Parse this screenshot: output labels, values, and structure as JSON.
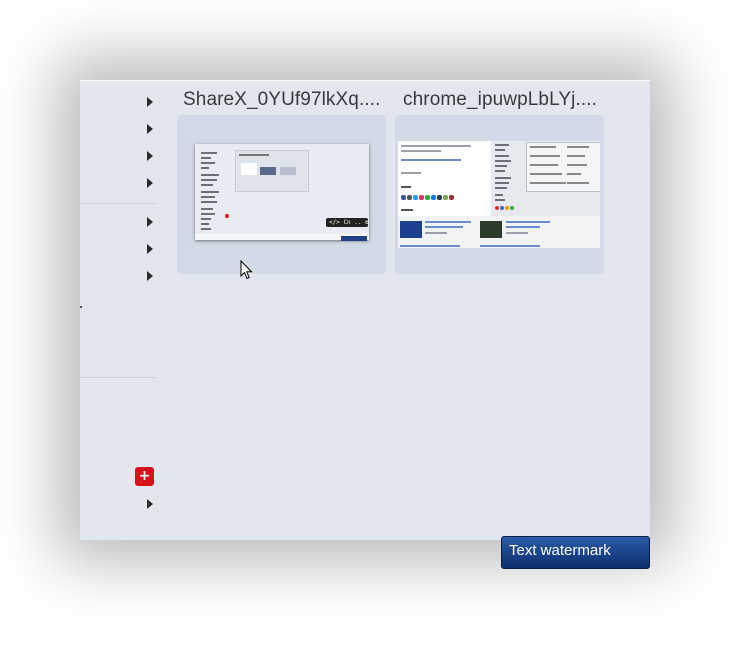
{
  "cards": [
    {
      "title": "ShareX_0YUf97lkXq...."
    },
    {
      "title": "chrome_ipuwpLbLYj...."
    }
  ],
  "thumb1": {
    "toolbar_text": "</> Cn .. ⚙"
  },
  "menu": {
    "add_button_label": "+"
  },
  "watermark": {
    "text": "Text watermark"
  },
  "colors": {
    "window_bg": "#e2e6ef",
    "card_bg": "#d3d9e6",
    "add_button": "#d8121b",
    "watermark_bg": "#0c2f6e"
  },
  "icons": [
    "submenu-arrow-icon",
    "add-icon",
    "mouse-cursor-icon"
  ]
}
